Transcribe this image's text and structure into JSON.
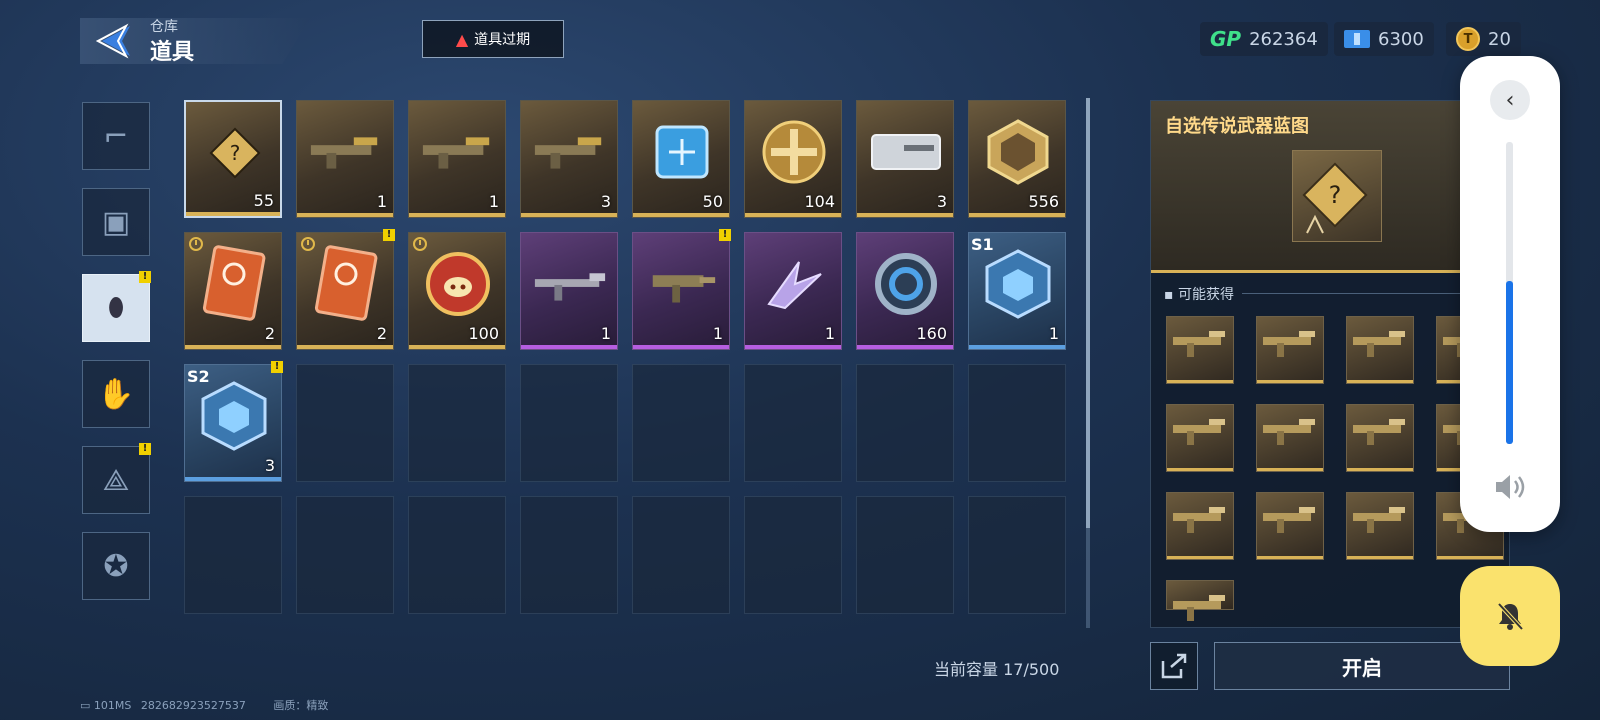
{
  "header": {
    "subtitle": "仓库",
    "title": "道具",
    "expire_button": "道具过期"
  },
  "currencies": [
    {
      "icon": "gp-icon",
      "label": "GP",
      "value": "262364"
    },
    {
      "icon": "ticket-icon",
      "value": "6300"
    },
    {
      "icon": "coin-icon",
      "value": "20"
    }
  ],
  "sidebar_tabs": [
    {
      "name": "tab-weapons",
      "icon": "pistol-icon",
      "active": false,
      "badge": false
    },
    {
      "name": "tab-skins",
      "icon": "frame-icon",
      "active": false,
      "badge": false
    },
    {
      "name": "tab-items",
      "icon": "item-tag-icon",
      "active": true,
      "badge": true
    },
    {
      "name": "tab-gestures",
      "icon": "hand-icon",
      "active": false,
      "badge": false
    },
    {
      "name": "tab-blueprints",
      "icon": "compass-icon",
      "active": false,
      "badge": true
    },
    {
      "name": "tab-rewards",
      "icon": "star-icon",
      "active": false,
      "badge": false
    }
  ],
  "items": [
    {
      "qty": "55",
      "rarity": "gold",
      "icon": "blueprint-question-icon",
      "selected": true
    },
    {
      "qty": "1",
      "rarity": "gold",
      "icon": "weapon-icon",
      "clock": false
    },
    {
      "qty": "1",
      "rarity": "gold",
      "icon": "weapon-icon"
    },
    {
      "qty": "3",
      "rarity": "gold",
      "icon": "weapon-icon"
    },
    {
      "qty": "50",
      "rarity": "gold",
      "icon": "chip-icon"
    },
    {
      "qty": "104",
      "rarity": "gold",
      "icon": "cross-medal-icon"
    },
    {
      "qty": "3",
      "rarity": "gold",
      "icon": "silver-case-icon"
    },
    {
      "qty": "556",
      "rarity": "gold",
      "icon": "hex-badge-icon"
    },
    {
      "qty": "2",
      "rarity": "gold",
      "icon": "orange-card-icon",
      "clock": true
    },
    {
      "qty": "2",
      "rarity": "gold",
      "icon": "orange-card-icon",
      "clock": true,
      "badge": true
    },
    {
      "qty": "100",
      "rarity": "gold",
      "icon": "pig-coin-icon",
      "clock": true
    },
    {
      "qty": "1",
      "rarity": "purple",
      "icon": "rifle-icon"
    },
    {
      "qty": "1",
      "rarity": "purple",
      "icon": "smg-icon",
      "badge": true
    },
    {
      "qty": "1",
      "rarity": "purple",
      "icon": "blade-icon"
    },
    {
      "qty": "160",
      "rarity": "purple",
      "icon": "ring-icon"
    },
    {
      "qty": "1",
      "rarity": "blue",
      "icon": "crystal-box-icon",
      "season": "S1"
    },
    {
      "qty": "3",
      "rarity": "blue",
      "icon": "crystal-box-icon",
      "season": "S2",
      "badge": true
    }
  ],
  "capacity_text": "当前容量 17/500",
  "footer": {
    "ping": "101MS",
    "id": "282682923527537",
    "quality": "画质：精致"
  },
  "detail": {
    "title": "自选传说武器蓝图",
    "possible_label": "可能获得",
    "open_button": "开启"
  },
  "colors": {
    "gold_bar": "#d8b257",
    "purple_bar": "#b65ee0",
    "blue_bar": "#5c9fe0",
    "volume_fill": "#1a73e8",
    "mute_button": "#fae26d"
  },
  "volume_overlay": {
    "level": 0.54
  }
}
